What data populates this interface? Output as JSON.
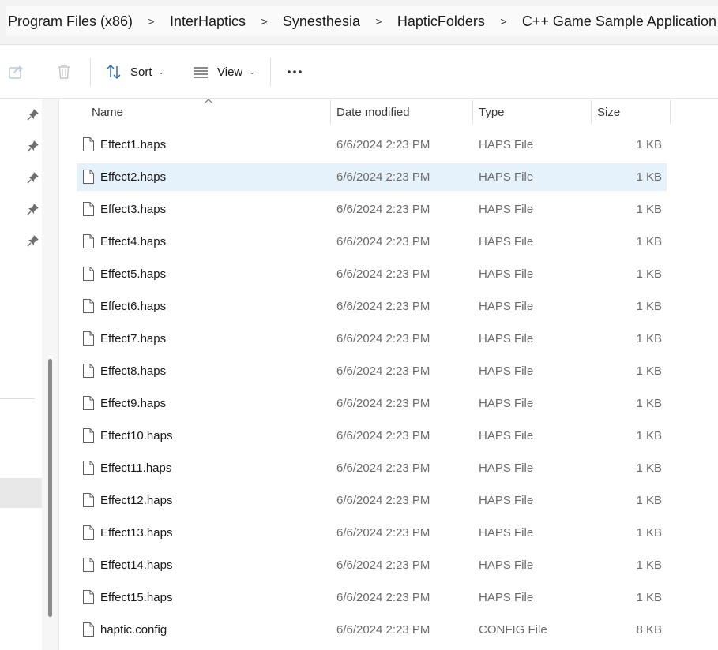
{
  "breadcrumb": {
    "items": [
      "Program Files (x86)",
      "InterHaptics",
      "Synesthesia",
      "HapticFolders",
      "C++ Game Sample Application"
    ],
    "separator": ">"
  },
  "toolbar": {
    "sort_label": "Sort",
    "view_label": "View",
    "more_label": "..."
  },
  "columns": {
    "name": "Name",
    "date": "Date modified",
    "type": "Type",
    "size": "Size"
  },
  "files": [
    {
      "name": "Effect1.haps",
      "date": "6/6/2024 2:23 PM",
      "type": "HAPS File",
      "size": "1 KB"
    },
    {
      "name": "Effect2.haps",
      "date": "6/6/2024 2:23 PM",
      "type": "HAPS File",
      "size": "1 KB"
    },
    {
      "name": "Effect3.haps",
      "date": "6/6/2024 2:23 PM",
      "type": "HAPS File",
      "size": "1 KB"
    },
    {
      "name": "Effect4.haps",
      "date": "6/6/2024 2:23 PM",
      "type": "HAPS File",
      "size": "1 KB"
    },
    {
      "name": "Effect5.haps",
      "date": "6/6/2024 2:23 PM",
      "type": "HAPS File",
      "size": "1 KB"
    },
    {
      "name": "Effect6.haps",
      "date": "6/6/2024 2:23 PM",
      "type": "HAPS File",
      "size": "1 KB"
    },
    {
      "name": "Effect7.haps",
      "date": "6/6/2024 2:23 PM",
      "type": "HAPS File",
      "size": "1 KB"
    },
    {
      "name": "Effect8.haps",
      "date": "6/6/2024 2:23 PM",
      "type": "HAPS File",
      "size": "1 KB"
    },
    {
      "name": "Effect9.haps",
      "date": "6/6/2024 2:23 PM",
      "type": "HAPS File",
      "size": "1 KB"
    },
    {
      "name": "Effect10.haps",
      "date": "6/6/2024 2:23 PM",
      "type": "HAPS File",
      "size": "1 KB"
    },
    {
      "name": "Effect11.haps",
      "date": "6/6/2024 2:23 PM",
      "type": "HAPS File",
      "size": "1 KB"
    },
    {
      "name": "Effect12.haps",
      "date": "6/6/2024 2:23 PM",
      "type": "HAPS File",
      "size": "1 KB"
    },
    {
      "name": "Effect13.haps",
      "date": "6/6/2024 2:23 PM",
      "type": "HAPS File",
      "size": "1 KB"
    },
    {
      "name": "Effect14.haps",
      "date": "6/6/2024 2:23 PM",
      "type": "HAPS File",
      "size": "1 KB"
    },
    {
      "name": "Effect15.haps",
      "date": "6/6/2024 2:23 PM",
      "type": "HAPS File",
      "size": "1 KB"
    },
    {
      "name": "haptic.config",
      "date": "6/6/2024 2:23 PM",
      "type": "CONFIG File",
      "size": "8 KB"
    }
  ],
  "selected_file": "Effect2.haps",
  "colors": {
    "selection": "#e5f1fb",
    "breadcrumb_bg": "#f3f3f3",
    "muted_text": "#6b6b6b"
  },
  "icons": [
    "share-icon",
    "delete-icon",
    "sort-icon",
    "view-icon",
    "more-icon",
    "pin-icon",
    "file-icon"
  ]
}
